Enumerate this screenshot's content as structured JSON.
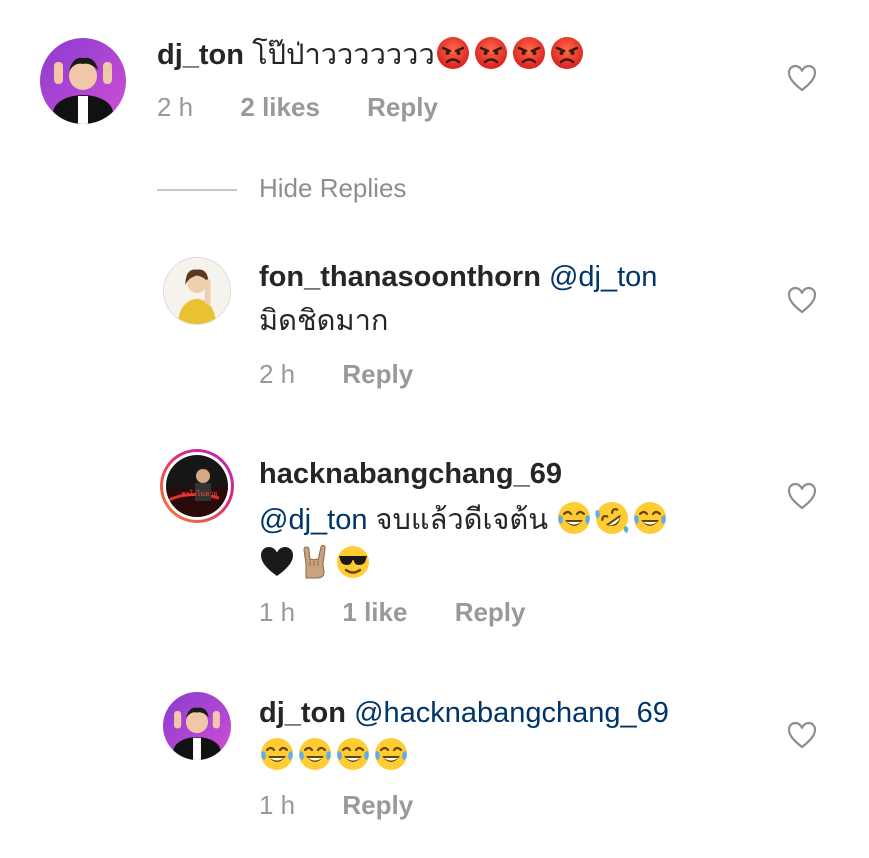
{
  "comment": {
    "username": "dj_ton",
    "text": "โป๊ป่าววววววว",
    "emoji": [
      "angry-face",
      "angry-face",
      "angry-face",
      "angry-face"
    ],
    "time": "2 h",
    "likes": "2 likes",
    "reply_label": "Reply"
  },
  "hide_replies_label": "Hide Replies",
  "replies": [
    {
      "username": "fon_thanasoonthorn",
      "mention": "@dj_ton",
      "text": "มิดชิดมาก",
      "time": "2 h",
      "reply_label": "Reply"
    },
    {
      "username": "hacknabangchang_69",
      "mention": "@dj_ton",
      "text": "จบแล้วดีเจต้น",
      "emoji_line1": [
        "tears-of-joy",
        "rolling-laughing",
        "tears-of-joy"
      ],
      "emoji_line2": [
        "black-heart",
        "rock-hand",
        "sunglasses-face"
      ],
      "time": "1 h",
      "likes": "1 like",
      "reply_label": "Reply"
    },
    {
      "username": "dj_ton",
      "mention": "@hacknabangchang_69",
      "emoji_line1": [
        "tears-of-joy",
        "tears-of-joy",
        "tears-of-joy",
        "tears-of-joy"
      ],
      "time": "1 h",
      "reply_label": "Reply"
    }
  ],
  "colors": {
    "mention": "#003569",
    "meta": "#999999",
    "story_ring_start": "#f58529",
    "story_ring_end": "#dd2a7b"
  }
}
